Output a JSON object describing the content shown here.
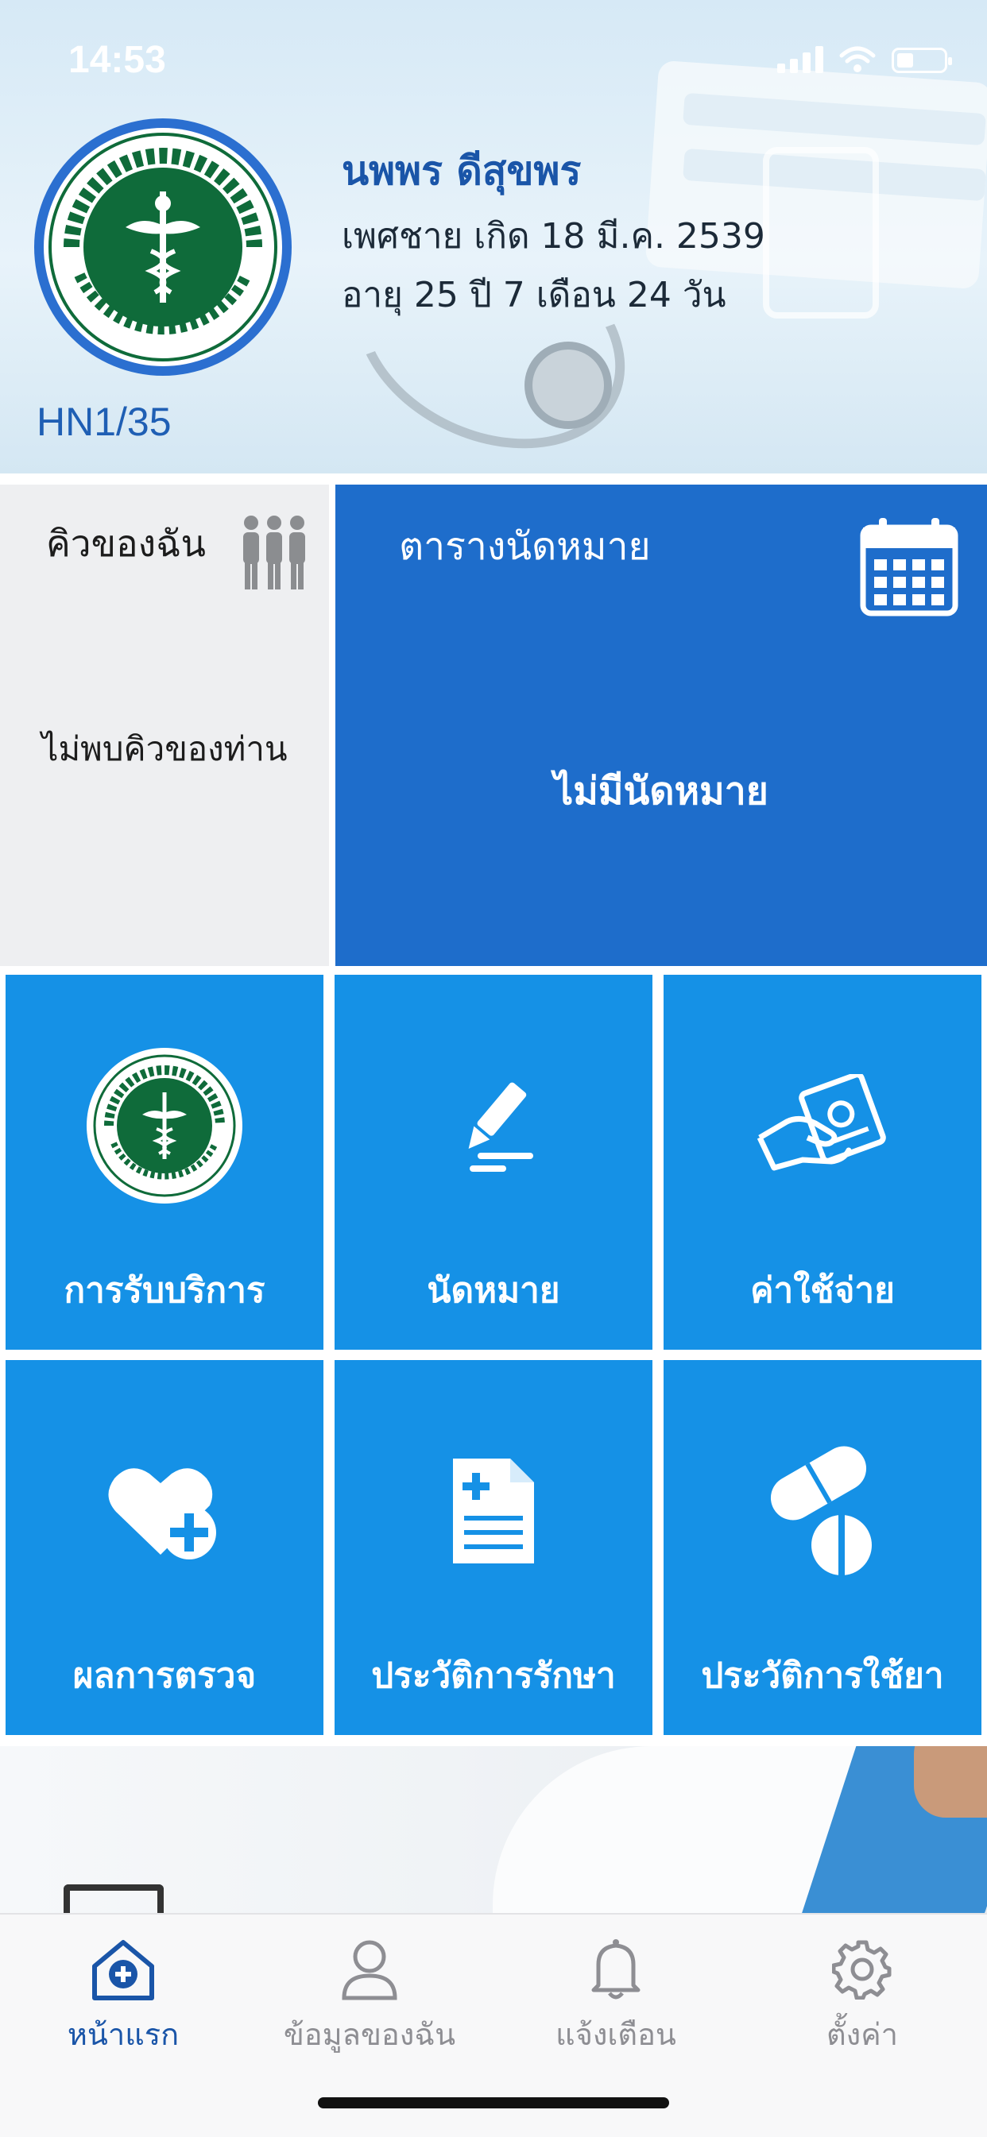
{
  "status_bar": {
    "time": "14:53"
  },
  "patient": {
    "hn": "HN1/35",
    "name": "นพพร ดีสุขพร",
    "sex_birth": "เพศชาย เกิด 18 มี.ค. 2539",
    "age": "อายุ 25 ปี 7 เดือน 24 วัน"
  },
  "queue": {
    "title": "คิวของฉัน",
    "empty_text": "ไม่พบคิวของท่าน",
    "icon": "people-queue-icon"
  },
  "appointment_schedule": {
    "title": "ตารางนัดหมาย",
    "empty_text": "ไม่มีนัดหมาย",
    "icon": "calendar-icon"
  },
  "menu": [
    {
      "label": "การรับบริการ",
      "icon": "ministry-logo-icon"
    },
    {
      "label": "นัดหมาย",
      "icon": "pencil-sign-icon"
    },
    {
      "label": "ค่าใช้จ่าย",
      "icon": "hand-payment-icon"
    },
    {
      "label": "ผลการตรวจ",
      "icon": "heart-plus-icon"
    },
    {
      "label": "ประวัติการรักษา",
      "icon": "medical-document-icon"
    },
    {
      "label": "ประวัติการใช้ยา",
      "icon": "pills-icon"
    }
  ],
  "tabs": [
    {
      "label": "หน้าแรก",
      "icon": "home-plus-icon",
      "active": true
    },
    {
      "label": "ข้อมูลของฉัน",
      "icon": "person-icon",
      "active": false
    },
    {
      "label": "แจ้งเตือน",
      "icon": "bell-icon",
      "active": false
    },
    {
      "label": "ตั้งค่า",
      "icon": "gear-icon",
      "active": false
    }
  ],
  "colors": {
    "primary_blue": "#1a55a8",
    "tile_blue": "#1591e6",
    "appointment_blue": "#1e6dcb",
    "logo_green": "#0f6b3a"
  }
}
